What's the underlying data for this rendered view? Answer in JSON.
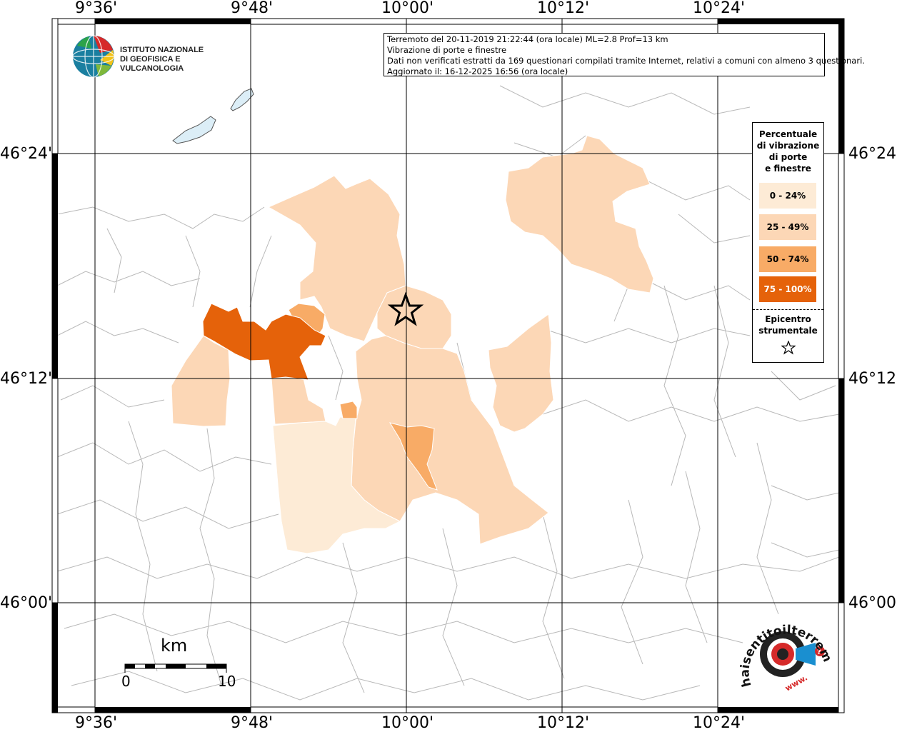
{
  "info": {
    "line1": "Terremoto del 20-11-2019 21:22:44 (ora locale) ML=2.8 Prof=13 km",
    "line2": "Vibrazione di porte e finestre",
    "line3": "Dati non verificati estratti da 169 questionari compilati tramite Internet, relativi a comuni con almeno 3 questionari.",
    "line4": "Aggiornato il: 16-12-2025 16:56 (ora locale)"
  },
  "logo": {
    "line1": "ISTITUTO NAZIONALE",
    "line2": "DI GEOFISICA E VULCANOLOGIA"
  },
  "axes": {
    "top": [
      "9°36'",
      "9°48'",
      "10°00'",
      "10°12'",
      "10°24'"
    ],
    "bottom": [
      "9°36'",
      "9°48'",
      "10°00'",
      "10°12'",
      "10°24'"
    ],
    "left": [
      "46°24'",
      "46°12'",
      "46°00'"
    ],
    "right": [
      "46°24'",
      "46°12'",
      "46°00'"
    ]
  },
  "legend": {
    "title_lines": [
      "Percentuale",
      "di vibrazione",
      "di porte",
      "e finestre"
    ],
    "classes": [
      {
        "label": "0 - 24%",
        "color": "#fdebd6",
        "text_color": "#000000"
      },
      {
        "label": "25 - 49%",
        "color": "#fcd7b6",
        "text_color": "#000000"
      },
      {
        "label": "50 - 74%",
        "color": "#f8ab66",
        "text_color": "#000000"
      },
      {
        "label": "75 - 100%",
        "color": "#e5620a",
        "text_color": "#ffffff"
      }
    ],
    "epicenter_lines": [
      "Epicentro",
      "strumentale"
    ]
  },
  "scale": {
    "unit": "km",
    "min": "0",
    "max": "10"
  },
  "watermark": {
    "text": "haisentitoilterremoto.it",
    "sub": "www."
  },
  "colors": {
    "lake": "#dceef7",
    "border": "#b8b8b8",
    "grid": "#000000"
  }
}
